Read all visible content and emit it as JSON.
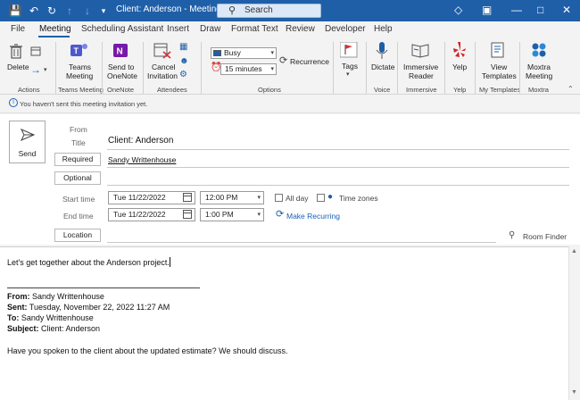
{
  "titlebar": {
    "title": "Client: Anderson  -  Meeting",
    "search_placeholder": "Search"
  },
  "menu": {
    "tabs": [
      "File",
      "Meeting",
      "Scheduling Assistant",
      "Insert",
      "Draw",
      "Format Text",
      "Review",
      "Developer",
      "Help"
    ],
    "active": "Meeting"
  },
  "ribbon": {
    "actions": {
      "delete_label": "Delete",
      "group_label": "Actions"
    },
    "teams": {
      "button_label_1": "Teams",
      "button_label_2": "Meeting",
      "group_label": "Teams Meeting"
    },
    "onenote": {
      "button_label_1": "Send to",
      "button_label_2": "OneNote",
      "group_label": "OneNote"
    },
    "attendees": {
      "cancel_label_1": "Cancel",
      "cancel_label_2": "Invitation",
      "group_label": "Attendees"
    },
    "options": {
      "show_as": "Busy",
      "reminder": "15 minutes",
      "recurrence_label": "Recurrence",
      "group_label": "Options"
    },
    "tags": {
      "button_label": "Tags"
    },
    "voice": {
      "button_label": "Dictate",
      "group_label": "Voice"
    },
    "immersive": {
      "button_label_1": "Immersive",
      "button_label_2": "Reader",
      "group_label": "Immersive"
    },
    "yelp": {
      "button_label": "Yelp",
      "group_label": "Yelp"
    },
    "templates": {
      "button_label_1": "View",
      "button_label_2": "Templates",
      "group_label": "My Templates"
    },
    "moxtra": {
      "button_label_1": "Moxtra",
      "button_label_2": "Meeting",
      "group_label": "Moxtra"
    }
  },
  "infobar": {
    "text": "You haven't sent this meeting invitation yet."
  },
  "form": {
    "send_label": "Send",
    "from_label": "From",
    "title_label": "Title",
    "title_value": "Client: Anderson",
    "required_label": "Required",
    "required_value": "Sandy Writtenhouse",
    "optional_label": "Optional",
    "start_label": "Start time",
    "start_date": "Tue 11/22/2022",
    "start_time": "12:00 PM",
    "end_label": "End time",
    "end_date": "Tue 11/22/2022",
    "end_time": "1:00 PM",
    "all_day_label": "All day",
    "time_zones_label": "Time zones",
    "make_recurring_label": "Make Recurring",
    "location_label": "Location",
    "room_finder_label": "Room Finder"
  },
  "body": {
    "line1": "Let's get together about the Anderson project.",
    "from_key": "From:",
    "from_val": " Sandy Writtenhouse",
    "sent_key": "Sent:",
    "sent_val": " Tuesday, November 22, 2022 11:27 AM",
    "to_key": "To:",
    "to_val": " Sandy Writtenhouse",
    "subject_key": "Subject:",
    "subject_val": " Client: Anderson",
    "line_last": "Have you spoken to the client about the updated estimate? We should discuss."
  },
  "colors": {
    "accent": "#1f5fa8",
    "link": "#1a5fb4"
  }
}
